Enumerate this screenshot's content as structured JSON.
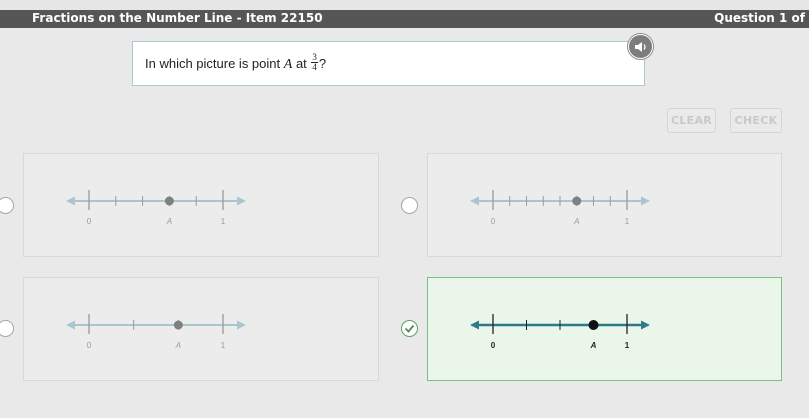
{
  "header": {
    "title": "Fractions on the Number Line - Item 22150",
    "question_number": "Question 1 of"
  },
  "question": {
    "prefix": "In which picture is point",
    "point_name": "A",
    "connector": "at",
    "fraction_numerator": "3",
    "fraction_denominator": "4",
    "suffix": "?"
  },
  "audio_icon": "speaker-icon",
  "buttons": {
    "clear": "CLEAR",
    "check": "CHECK"
  },
  "colors": {
    "line_inactive": "#a9c6d0",
    "line_active": "#2f7a89",
    "selected_bg": "#eaf6ea",
    "selected_border": "#7bbf83"
  },
  "choices": [
    {
      "id": "choice-1",
      "label_start": "0",
      "label_point": "A",
      "label_end": "1",
      "divisions": 5,
      "point_index": 3,
      "selected": false
    },
    {
      "id": "choice-2",
      "label_start": "0",
      "label_point": "A",
      "label_end": "1",
      "divisions": 8,
      "point_index": 5,
      "selected": false
    },
    {
      "id": "choice-3",
      "label_start": "0",
      "label_point": "A",
      "label_end": "1",
      "divisions": 3,
      "point_index": 2,
      "selected": false
    },
    {
      "id": "choice-4",
      "label_start": "0",
      "label_point": "A",
      "label_end": "1",
      "divisions": 4,
      "point_index": 3,
      "selected": true
    }
  ]
}
